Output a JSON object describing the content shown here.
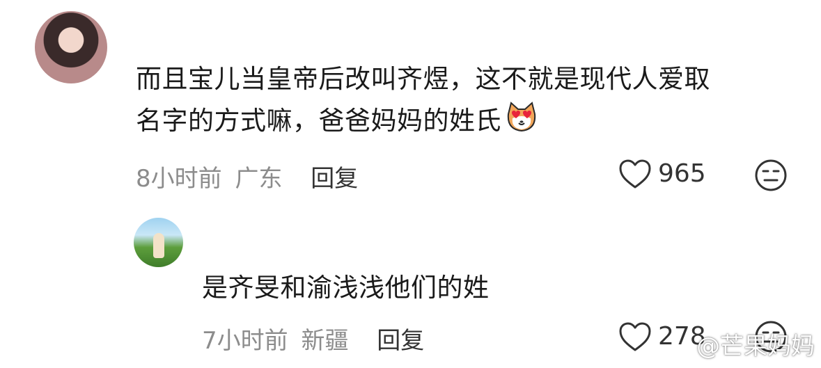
{
  "comment": {
    "line1": "而且宝儿当皇帝后改叫齐煜，这不就是现代人爱取",
    "line2": "名字的方式嘛，爸爸妈妈的姓氏",
    "emoji": "heart-eyes-cat-emoji",
    "time": "8小时前",
    "location": "广东",
    "reply_label": "回复",
    "likes": "965",
    "dislike_icon": "meh-face-icon"
  },
  "reply": {
    "text": "是齐旻和渝浅浅他们的姓",
    "time": "7小时前",
    "location": "新疆",
    "reply_label": "回复",
    "likes": "278"
  },
  "watermark": "@芒果妈妈",
  "colors": {
    "text": "#1a1a1a",
    "meta": "#8c8c8c",
    "action": "#333333"
  }
}
